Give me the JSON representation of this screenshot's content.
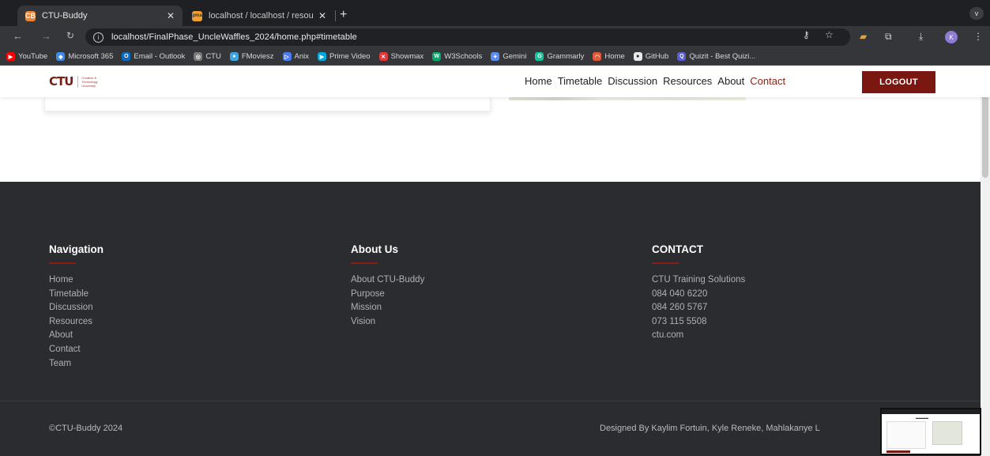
{
  "browser": {
    "tabs": [
      {
        "title": "CTU-Buddy",
        "favicon": "CB"
      },
      {
        "title": "localhost / localhost / resourc",
        "favicon": "pma"
      }
    ],
    "new_tab": "+",
    "menu_glyph": "v",
    "url": "localhost/FinalPhase_UncleWaffles_2024/home.php#timetable",
    "avatar": "K",
    "bookmarks": [
      {
        "label": "YouTube",
        "color": "#ff0000",
        "glyph": "▶"
      },
      {
        "label": "Microsoft 365",
        "color": "#3c8ce7",
        "glyph": "◆"
      },
      {
        "label": "Email - Outlook",
        "color": "#0f6cbd",
        "glyph": "O"
      },
      {
        "label": "CTU",
        "color": "#7a7a7a",
        "glyph": "◎"
      },
      {
        "label": "FMoviesz",
        "color": "#3ba6e0",
        "glyph": "●"
      },
      {
        "label": "Anix",
        "color": "#4a7cf0",
        "glyph": "▷"
      },
      {
        "label": "Prime Video",
        "color": "#00a8e1",
        "glyph": "▶"
      },
      {
        "label": "Showmax",
        "color": "#e23a3a",
        "glyph": "✕"
      },
      {
        "label": "W3Schools",
        "color": "#04aa6d",
        "glyph": "W"
      },
      {
        "label": "Gemini",
        "color": "#5a8df0",
        "glyph": "✦"
      },
      {
        "label": "Grammarly",
        "color": "#15c39a",
        "glyph": "G"
      },
      {
        "label": "Home",
        "color": "#e05a3a",
        "glyph": "◠"
      },
      {
        "label": "GitHub",
        "color": "#e8e8e8",
        "glyph": "●"
      },
      {
        "label": "Quizit - Best Quizi...",
        "color": "#5b5bd6",
        "glyph": "Q"
      }
    ]
  },
  "site": {
    "logo_mark": "CTU",
    "logo_subtitle": [
      "Creative &",
      "Technology",
      "University"
    ],
    "nav": [
      "Home",
      "Timetable",
      "Discussion",
      "Resources",
      "About",
      "Contact"
    ],
    "logout_label": "LOGOUT"
  },
  "footer": {
    "columns": [
      {
        "heading": "Navigation",
        "items": [
          "Home",
          "Timetable",
          "Discussion",
          "Resources",
          "About",
          "Contact",
          "Team"
        ]
      },
      {
        "heading": "About Us",
        "items": [
          "About CTU-Buddy",
          "Purpose",
          "Mission",
          "Vision"
        ]
      },
      {
        "heading": "CONTACT",
        "items": [
          "CTU Training Solutions",
          "084 040 6220",
          "084 260 5767",
          "073 115 5508",
          "ctu.com"
        ]
      }
    ],
    "copyright": "©CTU-Buddy 2024",
    "designed_by": "Designed By Kaylim Fortuin, Kyle Reneke, Mahlakanye L"
  },
  "colors": {
    "accent": "#7b1711",
    "footer_bg": "#2b2c30",
    "chrome_bg": "#35363a"
  }
}
